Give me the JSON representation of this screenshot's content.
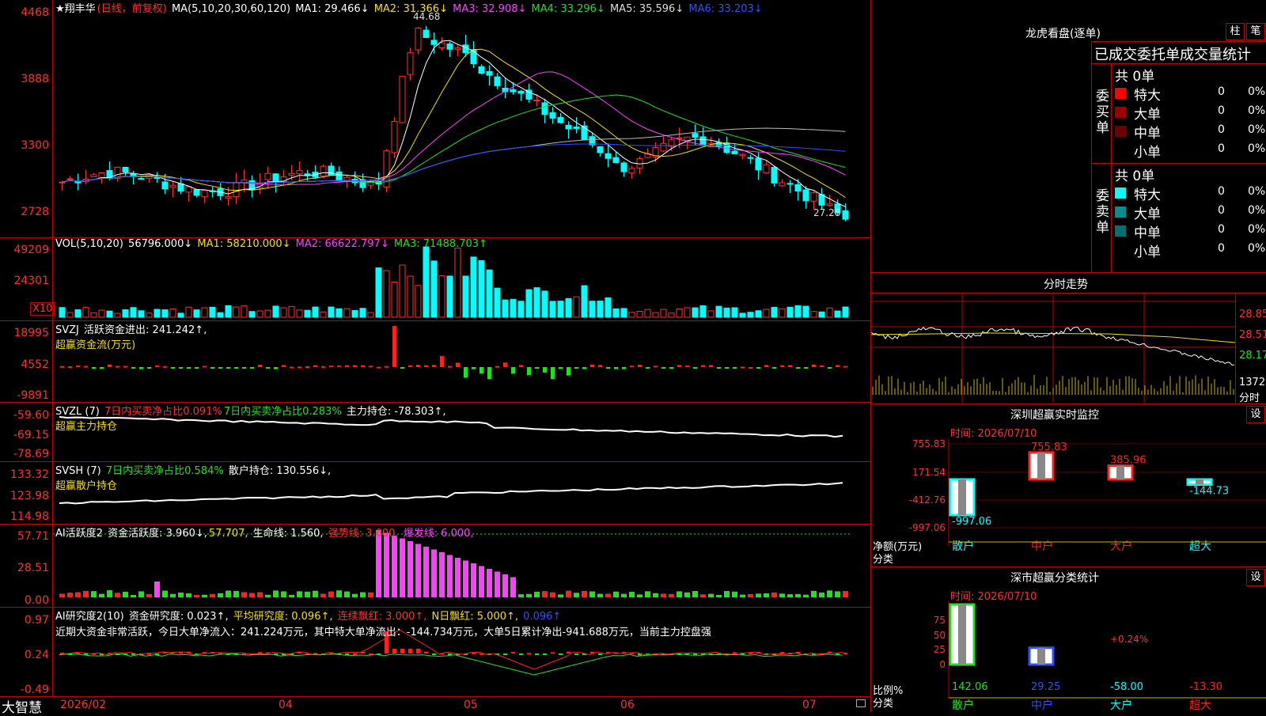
{
  "app_name": "大智慧",
  "stock": {
    "name": "★翔丰华",
    "mode": "(日线，前复权)"
  },
  "ma_line": {
    "label": "MA(5,10,20,30,60,120)",
    "items": [
      {
        "t": "MA1: 29.466↓",
        "c": "#ffffff"
      },
      {
        "t": "MA2: 31.366↓",
        "c": "#f5e000"
      },
      {
        "t": "MA3: 32.908↓",
        "c": "#ff40ff"
      },
      {
        "t": "MA4: 33.296↓",
        "c": "#20e020"
      },
      {
        "t": "MA5: 35.596↓",
        "c": "#dddddd"
      },
      {
        "t": "MA6: 33.203↓",
        "c": "#3050ff"
      }
    ]
  },
  "price_axis": [
    "4468",
    "3888",
    "3300",
    "2728"
  ],
  "price_notes": {
    "high": "44.68",
    "low": "27.28"
  },
  "vol": {
    "label": "VOL(5,10,20)",
    "v": "56796.000↓",
    "ma1": "MA1: 58210.000↓",
    "ma2": "MA2: 66622.797↓",
    "ma3": "MA3: 71488.703↑",
    "axis": [
      "49209",
      "24301"
    ],
    "unit": "X10"
  },
  "svzj": {
    "label": "SVZJ",
    "t1": "活跃资金进出: 241.242↑,",
    "t2": "超赢资金流(万元)",
    "axis": [
      "18995",
      "4552",
      "-9891"
    ]
  },
  "svzl": {
    "label": "SVZL (7)",
    "t1": "7日内买卖净占比0.091%",
    "t2": "7日内买卖净占比0.283%",
    "t3": "主力持仓: -78.303↑,",
    "t4": "超赢主力持仓",
    "axis": [
      "-59.60",
      "-69.15",
      "-78.69"
    ]
  },
  "svsh": {
    "label": "SVSH (7)",
    "t1": "7日内买卖净占比0.584%",
    "t2": "散户持仓: 130.556↓,",
    "t3": "超赢散户持仓",
    "axis": [
      "133.32",
      "123.98",
      "114.98"
    ]
  },
  "ai1": {
    "label": "AI活跃度2",
    "t1": "资金活跃度: 3.960↓,",
    "t2": "57.707,",
    "t3": "生命线: 1.560,",
    "t4": "强势线: 3.000,",
    "t5": "爆发线: 6.000,",
    "axis": [
      "57.71",
      "28.51",
      "0.00"
    ]
  },
  "ai2": {
    "label": "AI研究度2(10)",
    "t1": "资金研究度: 0.023↑,",
    "t2": "平均研究度: 0.096↑,",
    "t3": "连续飘红: 3.000↑,",
    "t4": "N日飘红: 5.000↑,",
    "t5": "0.096↑",
    "summary": "近期大资金非常活跃，今日大单净流入：241.224万元，其中特大单净流出：-144.734万元，大单5日累计净出-941.688万元，当前主力控盘强",
    "axis": [
      "0.97",
      "0.24",
      "-0.49"
    ]
  },
  "x_axis": [
    "2026/02",
    "04",
    "05",
    "06",
    "07"
  ],
  "right": {
    "lhb": {
      "title": "龙虎看盘(逐单)",
      "btn1": "柱",
      "btn2": "笔",
      "header": "已成交委托单成交量统计",
      "buy": {
        "side": "委买单",
        "total": "共 0单",
        "rows": [
          {
            "n": "特大",
            "v": "0",
            "p": "0%",
            "c": "#ff0000"
          },
          {
            "n": "大单",
            "v": "0",
            "p": "0%",
            "c": "#a00000"
          },
          {
            "n": "中单",
            "v": "0",
            "p": "0%",
            "c": "#700000"
          },
          {
            "n": "小单",
            "v": "0",
            "p": "0%",
            "c": ""
          }
        ]
      },
      "sell": {
        "side": "委卖单",
        "total": "共 0单",
        "rows": [
          {
            "n": "特大",
            "v": "0",
            "p": "0%",
            "c": "#00ffff"
          },
          {
            "n": "大单",
            "v": "0",
            "p": "0%",
            "c": "#009090"
          },
          {
            "n": "中单",
            "v": "0",
            "p": "0%",
            "c": "#007070"
          },
          {
            "n": "小单",
            "v": "0",
            "p": "0%",
            "c": ""
          }
        ]
      }
    },
    "fs": {
      "title": "分时走势",
      "axis": [
        "28.85",
        "28.51",
        "28.17"
      ],
      "vol": "1372",
      "unit": "分时"
    },
    "sz": {
      "title": "深圳超赢实时监控",
      "btn": "设",
      "time": "时间: 2026/07/10",
      "axis": [
        "755.83",
        "171.54",
        "-412.76",
        "-997.06"
      ],
      "bars": [
        {
          "cat": "散户",
          "v": "-997.06",
          "val": -997.06
        },
        {
          "cat": "中户",
          "v": "755.83",
          "val": 755.83
        },
        {
          "cat": "大户",
          "v": "385.96",
          "val": 385.96
        },
        {
          "cat": "超大",
          "v": "-144.73",
          "val": -144.73
        }
      ],
      "ylabel": "净额(万元)",
      "xlabel": "分类"
    },
    "szfl": {
      "title": "深市超赢分类统计",
      "btn": "设",
      "time": "时间: 2026/07/10",
      "axis": [
        "75",
        "50",
        "25",
        "0"
      ],
      "bars": [
        {
          "cat": "散户",
          "v": "142.06",
          "val": 100
        },
        {
          "cat": "中户",
          "v": "29.25",
          "val": 28
        },
        {
          "cat": "大户",
          "v": "-58.00",
          "val": 0
        },
        {
          "cat": "超大",
          "v": "-13.30",
          "val": 0
        }
      ],
      "note": "+0.24%",
      "ylabel": "比例%",
      "xlabel": "分类"
    }
  }
}
